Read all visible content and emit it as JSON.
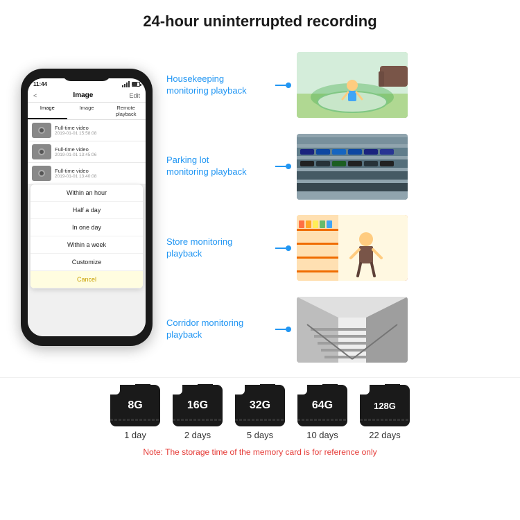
{
  "header": {
    "title": "24-hour uninterrupted recording"
  },
  "phone": {
    "status_time": "11:44",
    "nav_title": "Image",
    "nav_back": "<",
    "nav_edit": "Edit",
    "tabs": [
      "Image",
      "Image",
      "Remote playback"
    ],
    "list_items": [
      {
        "title": "Full-time video",
        "date": "2019-01-01 15:58:08"
      },
      {
        "title": "Full-time video",
        "date": "2019-01-01 13:45:06"
      },
      {
        "title": "Full-time video",
        "date": "2019-01-01 13:40:08"
      }
    ],
    "dropdown_items": [
      "Within an hour",
      "Half a day",
      "In one day",
      "Within a week",
      "Customize"
    ],
    "cancel_label": "Cancel"
  },
  "monitoring": [
    {
      "label": "Housekeeping\nmonitoring playback",
      "photo_type": "housekeeping"
    },
    {
      "label": "Parking lot\nmonitoring playback",
      "photo_type": "parking"
    },
    {
      "label": "Store monitoring\nplayback",
      "photo_type": "store"
    },
    {
      "label": "Corridor monitoring\nplayback",
      "photo_type": "corridor"
    }
  ],
  "sd_cards": [
    {
      "capacity": "8G",
      "days": "1 day"
    },
    {
      "capacity": "16G",
      "days": "2 days"
    },
    {
      "capacity": "32G",
      "days": "5 days"
    },
    {
      "capacity": "64G",
      "days": "10 days"
    },
    {
      "capacity": "128G",
      "days": "22 days"
    }
  ],
  "note": {
    "text": "Note: The storage time of the memory card is for reference only"
  }
}
